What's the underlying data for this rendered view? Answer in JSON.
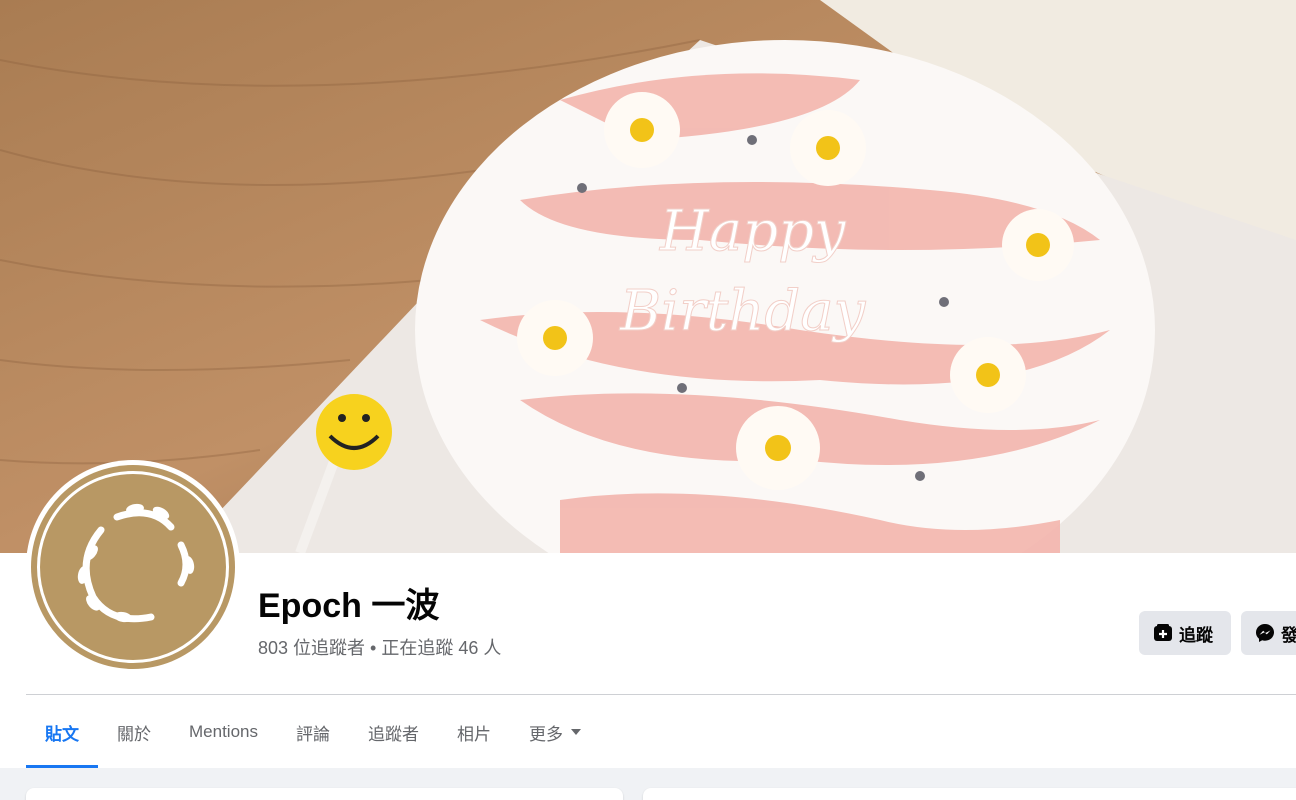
{
  "page": {
    "name": "Epoch 一波",
    "stats": "803 位追蹤者 • 正在追蹤 46 人"
  },
  "actions": {
    "follow_label": "追蹤",
    "message_label": "發"
  },
  "tabs": [
    {
      "label": "貼文",
      "active": true
    },
    {
      "label": "關於"
    },
    {
      "label": "Mentions"
    },
    {
      "label": "評論"
    },
    {
      "label": "追蹤者"
    },
    {
      "label": "相片"
    },
    {
      "label": "更多"
    }
  ],
  "cover": {
    "cake_text_line1": "Happy",
    "cake_text_line2": "Birthday"
  },
  "colors": {
    "accent": "#1877f2",
    "avatar_bg": "#b89864",
    "button_bg": "#e4e6eb"
  },
  "icons": {
    "follow": "follow-icon",
    "message": "messenger-icon",
    "more": "caret-down-icon"
  }
}
